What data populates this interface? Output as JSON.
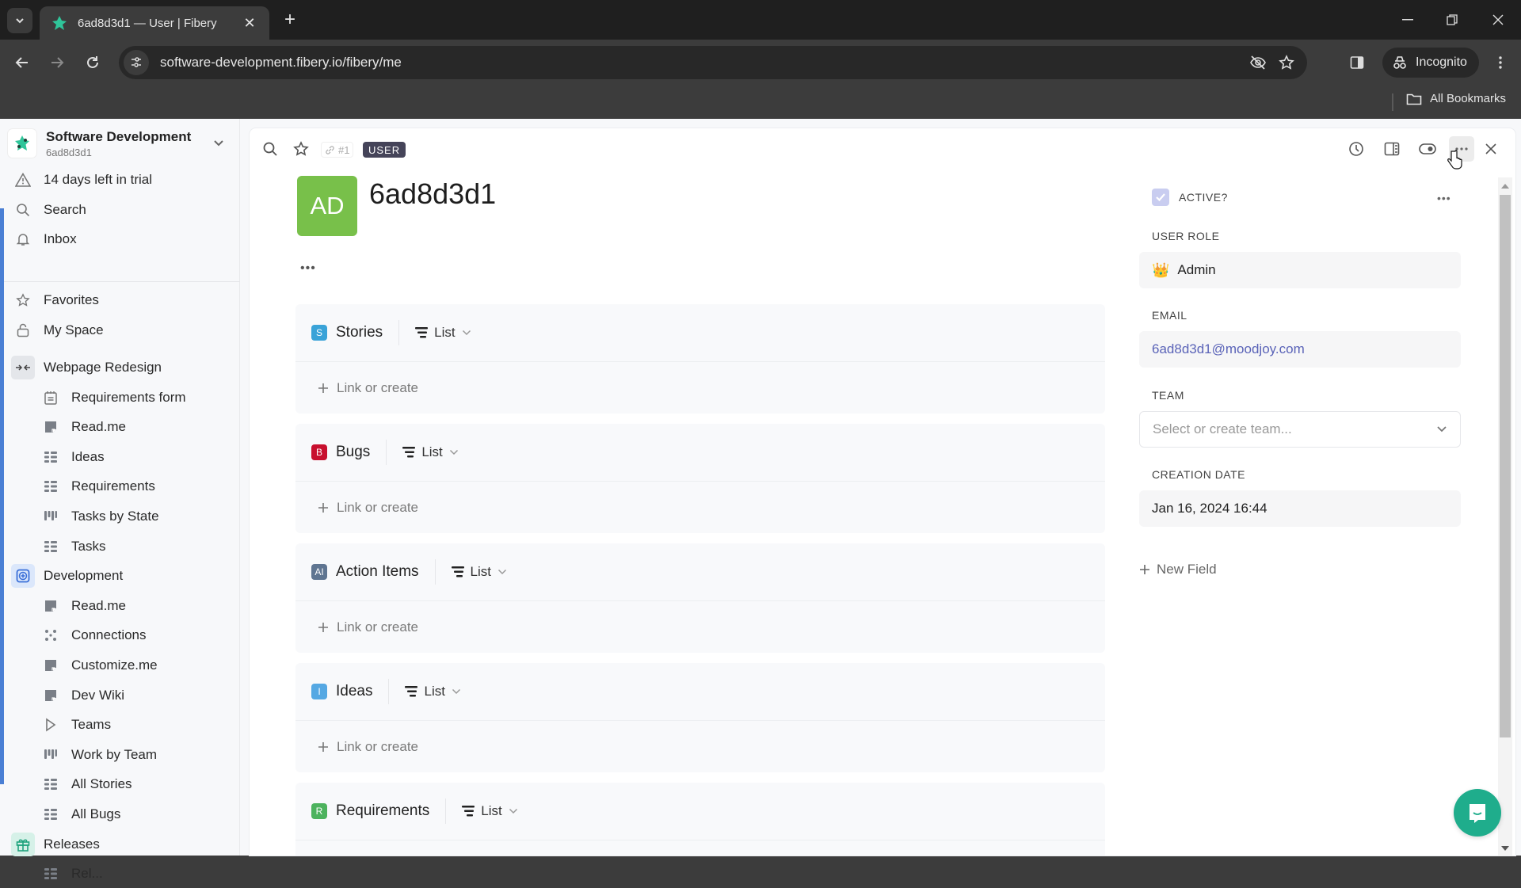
{
  "browser": {
    "tab_title": "6ad8d3d1 — User | Fibery",
    "url": "software-development.fibery.io/fibery/me",
    "incognito_label": "Incognito",
    "bookmarks_label": "All Bookmarks"
  },
  "workspace": {
    "name": "Software Development",
    "user": "6ad8d3d1"
  },
  "sidebar": {
    "top_items": [
      {
        "label": "14 days left in trial",
        "icon": "warning-icon"
      },
      {
        "label": "Search",
        "icon": "search-icon"
      },
      {
        "label": "Inbox",
        "icon": "bell-icon"
      },
      {
        "label": "Favorites",
        "icon": "star-icon"
      },
      {
        "label": "My Space",
        "icon": "lock-icon"
      }
    ],
    "spaces": [
      {
        "label": "Webpage Redesign",
        "icon": "arrows-collapse-icon",
        "color": "#e4e6ea",
        "items": [
          {
            "label": "Requirements form",
            "icon": "form-icon"
          },
          {
            "label": "Read.me",
            "icon": "document-icon"
          },
          {
            "label": "Ideas",
            "icon": "grid-icon"
          },
          {
            "label": "Requirements",
            "icon": "grid-icon"
          },
          {
            "label": "Tasks by State",
            "icon": "board-icon"
          },
          {
            "label": "Tasks",
            "icon": "grid-icon"
          }
        ]
      },
      {
        "label": "Development",
        "icon": "plus-square-icon",
        "color": "#dbe7fb",
        "items": [
          {
            "label": "Read.me",
            "icon": "document-icon"
          },
          {
            "label": "Connections",
            "icon": "connections-icon"
          },
          {
            "label": "Customize.me",
            "icon": "document-icon"
          },
          {
            "label": "Dev Wiki",
            "icon": "document-icon"
          },
          {
            "label": "Teams",
            "icon": "play-icon"
          },
          {
            "label": "Work by Team",
            "icon": "board-icon"
          },
          {
            "label": "All Stories",
            "icon": "grid-icon"
          },
          {
            "label": "All Bugs",
            "icon": "grid-icon"
          }
        ]
      },
      {
        "label": "Releases",
        "icon": "gift-icon",
        "color": "#d6f1e8",
        "items": [
          {
            "label": "Rel...",
            "icon": "grid-icon"
          }
        ]
      }
    ]
  },
  "record": {
    "id": "#1",
    "type": "USER",
    "avatar_initials": "AD",
    "avatar_color": "#78c04a",
    "title": "6ad8d3d1"
  },
  "relations": [
    {
      "badge": "S",
      "badge_color": "#3aa3d8",
      "name": "Stories",
      "view": "List",
      "action": "Link or create"
    },
    {
      "badge": "B",
      "badge_color": "#c8102e",
      "name": "Bugs",
      "view": "List",
      "action": "Link or create"
    },
    {
      "badge": "AI",
      "badge_color": "#5f7591",
      "name": "Action Items",
      "view": "List",
      "action": "Link or create"
    },
    {
      "badge": "I",
      "badge_color": "#55a8e3",
      "name": "Ideas",
      "view": "List",
      "action": "Link or create"
    },
    {
      "badge": "R",
      "badge_color": "#4db35e",
      "name": "Requirements",
      "view": "List",
      "action": ""
    }
  ],
  "fields": {
    "active": {
      "label": "ACTIVE?",
      "checked": true
    },
    "user_role": {
      "label": "USER ROLE",
      "value": "Admin"
    },
    "email": {
      "label": "EMAIL",
      "value": "6ad8d3d1@moodjoy.com"
    },
    "team": {
      "label": "TEAM",
      "placeholder": "Select or create team..."
    },
    "creation_date": {
      "label": "CREATION DATE",
      "value": "Jan 16, 2024 16:44"
    },
    "new_field_label": "New Field"
  },
  "colors": {
    "link": "#5a63b8",
    "accent": "#4a7fd4",
    "chat": "#1fad8c"
  }
}
